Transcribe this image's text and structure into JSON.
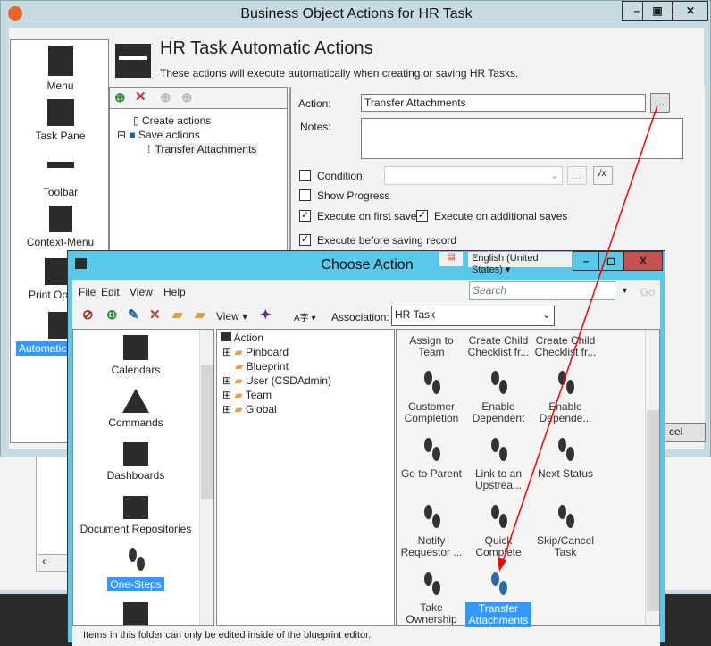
{
  "main_window": {
    "title": "Business Object Actions for HR Task",
    "header_title": "HR Task Automatic Actions",
    "header_subtitle": "These actions will execute automatically when creating or saving HR Tasks.",
    "sidebar": [
      {
        "label": "Menu",
        "icon": "menu-icon"
      },
      {
        "label": "Task Pane",
        "icon": "task-pane-icon"
      },
      {
        "label": "Toolbar",
        "icon": "toolbar-icon"
      },
      {
        "label": "Context-Menu",
        "icon": "context-menu-icon"
      },
      {
        "label": "Print Opt",
        "icon": "printer-icon"
      },
      {
        "label": "Automatic A",
        "icon": "clapperboard-icon",
        "selected": true
      }
    ],
    "tree": {
      "create": "Create actions",
      "save": "Save actions",
      "child": "Transfer Attachments"
    },
    "form": {
      "action_label": "Action:",
      "action_value": "Transfer Attachments",
      "browse": "...",
      "notes_label": "Notes:",
      "notes_value": "",
      "condition_label": "Condition:",
      "condition_checked": false,
      "show_progress": "Show Progress",
      "show_progress_checked": false,
      "first_save": "Execute on first save",
      "first_save_checked": true,
      "additional_saves": "Execute on additional saves",
      "additional_saves_checked": true,
      "before_saving": "Execute before saving record",
      "before_saving_checked": true,
      "cancel_partial": "cel"
    }
  },
  "dialog": {
    "title": "Choose Action",
    "language": "English (United States)",
    "menu": [
      "File",
      "Edit",
      "View",
      "Help"
    ],
    "search_placeholder": "Search",
    "go": "Go",
    "view_label": "View",
    "association_label": "Association:",
    "association_value": "HR Task",
    "categories": [
      "Calendars",
      "Commands",
      "Dashboards",
      "Document Repositories",
      "One-Steps"
    ],
    "selected_category": "One-Steps",
    "tree": {
      "root": "Action",
      "children": [
        "Pinboard",
        "Blueprint",
        "User (CSDAdmin)",
        "Team",
        "Global"
      ]
    },
    "actions": [
      [
        "Assign to",
        "Team"
      ],
      [
        "Create Child",
        "Checklist fr..."
      ],
      [
        "Create Child",
        "Checklist fr..."
      ],
      [
        "Customer",
        "Completion"
      ],
      [
        "Enable",
        "Dependent"
      ],
      [
        "Enable",
        "Depende..."
      ],
      [
        "Go to Parent",
        ""
      ],
      [
        "Link to an",
        "Upstrea..."
      ],
      [
        "Next Status",
        ""
      ],
      [
        "Notify",
        "Requestor ..."
      ],
      [
        "Quick",
        "Complete"
      ],
      [
        "Skip/Cancel",
        "Task"
      ],
      [
        "Take",
        "Ownership"
      ],
      [
        "Transfer",
        "Attachments"
      ]
    ],
    "selected_action": "Transfer Attachments",
    "status": "Items in this folder can only be edited inside of the blueprint editor."
  },
  "colors": {
    "dialog_frame": "#5ac8e9",
    "selection": "#3399ff",
    "close": "#c75050",
    "arrow": "#ff0000"
  }
}
